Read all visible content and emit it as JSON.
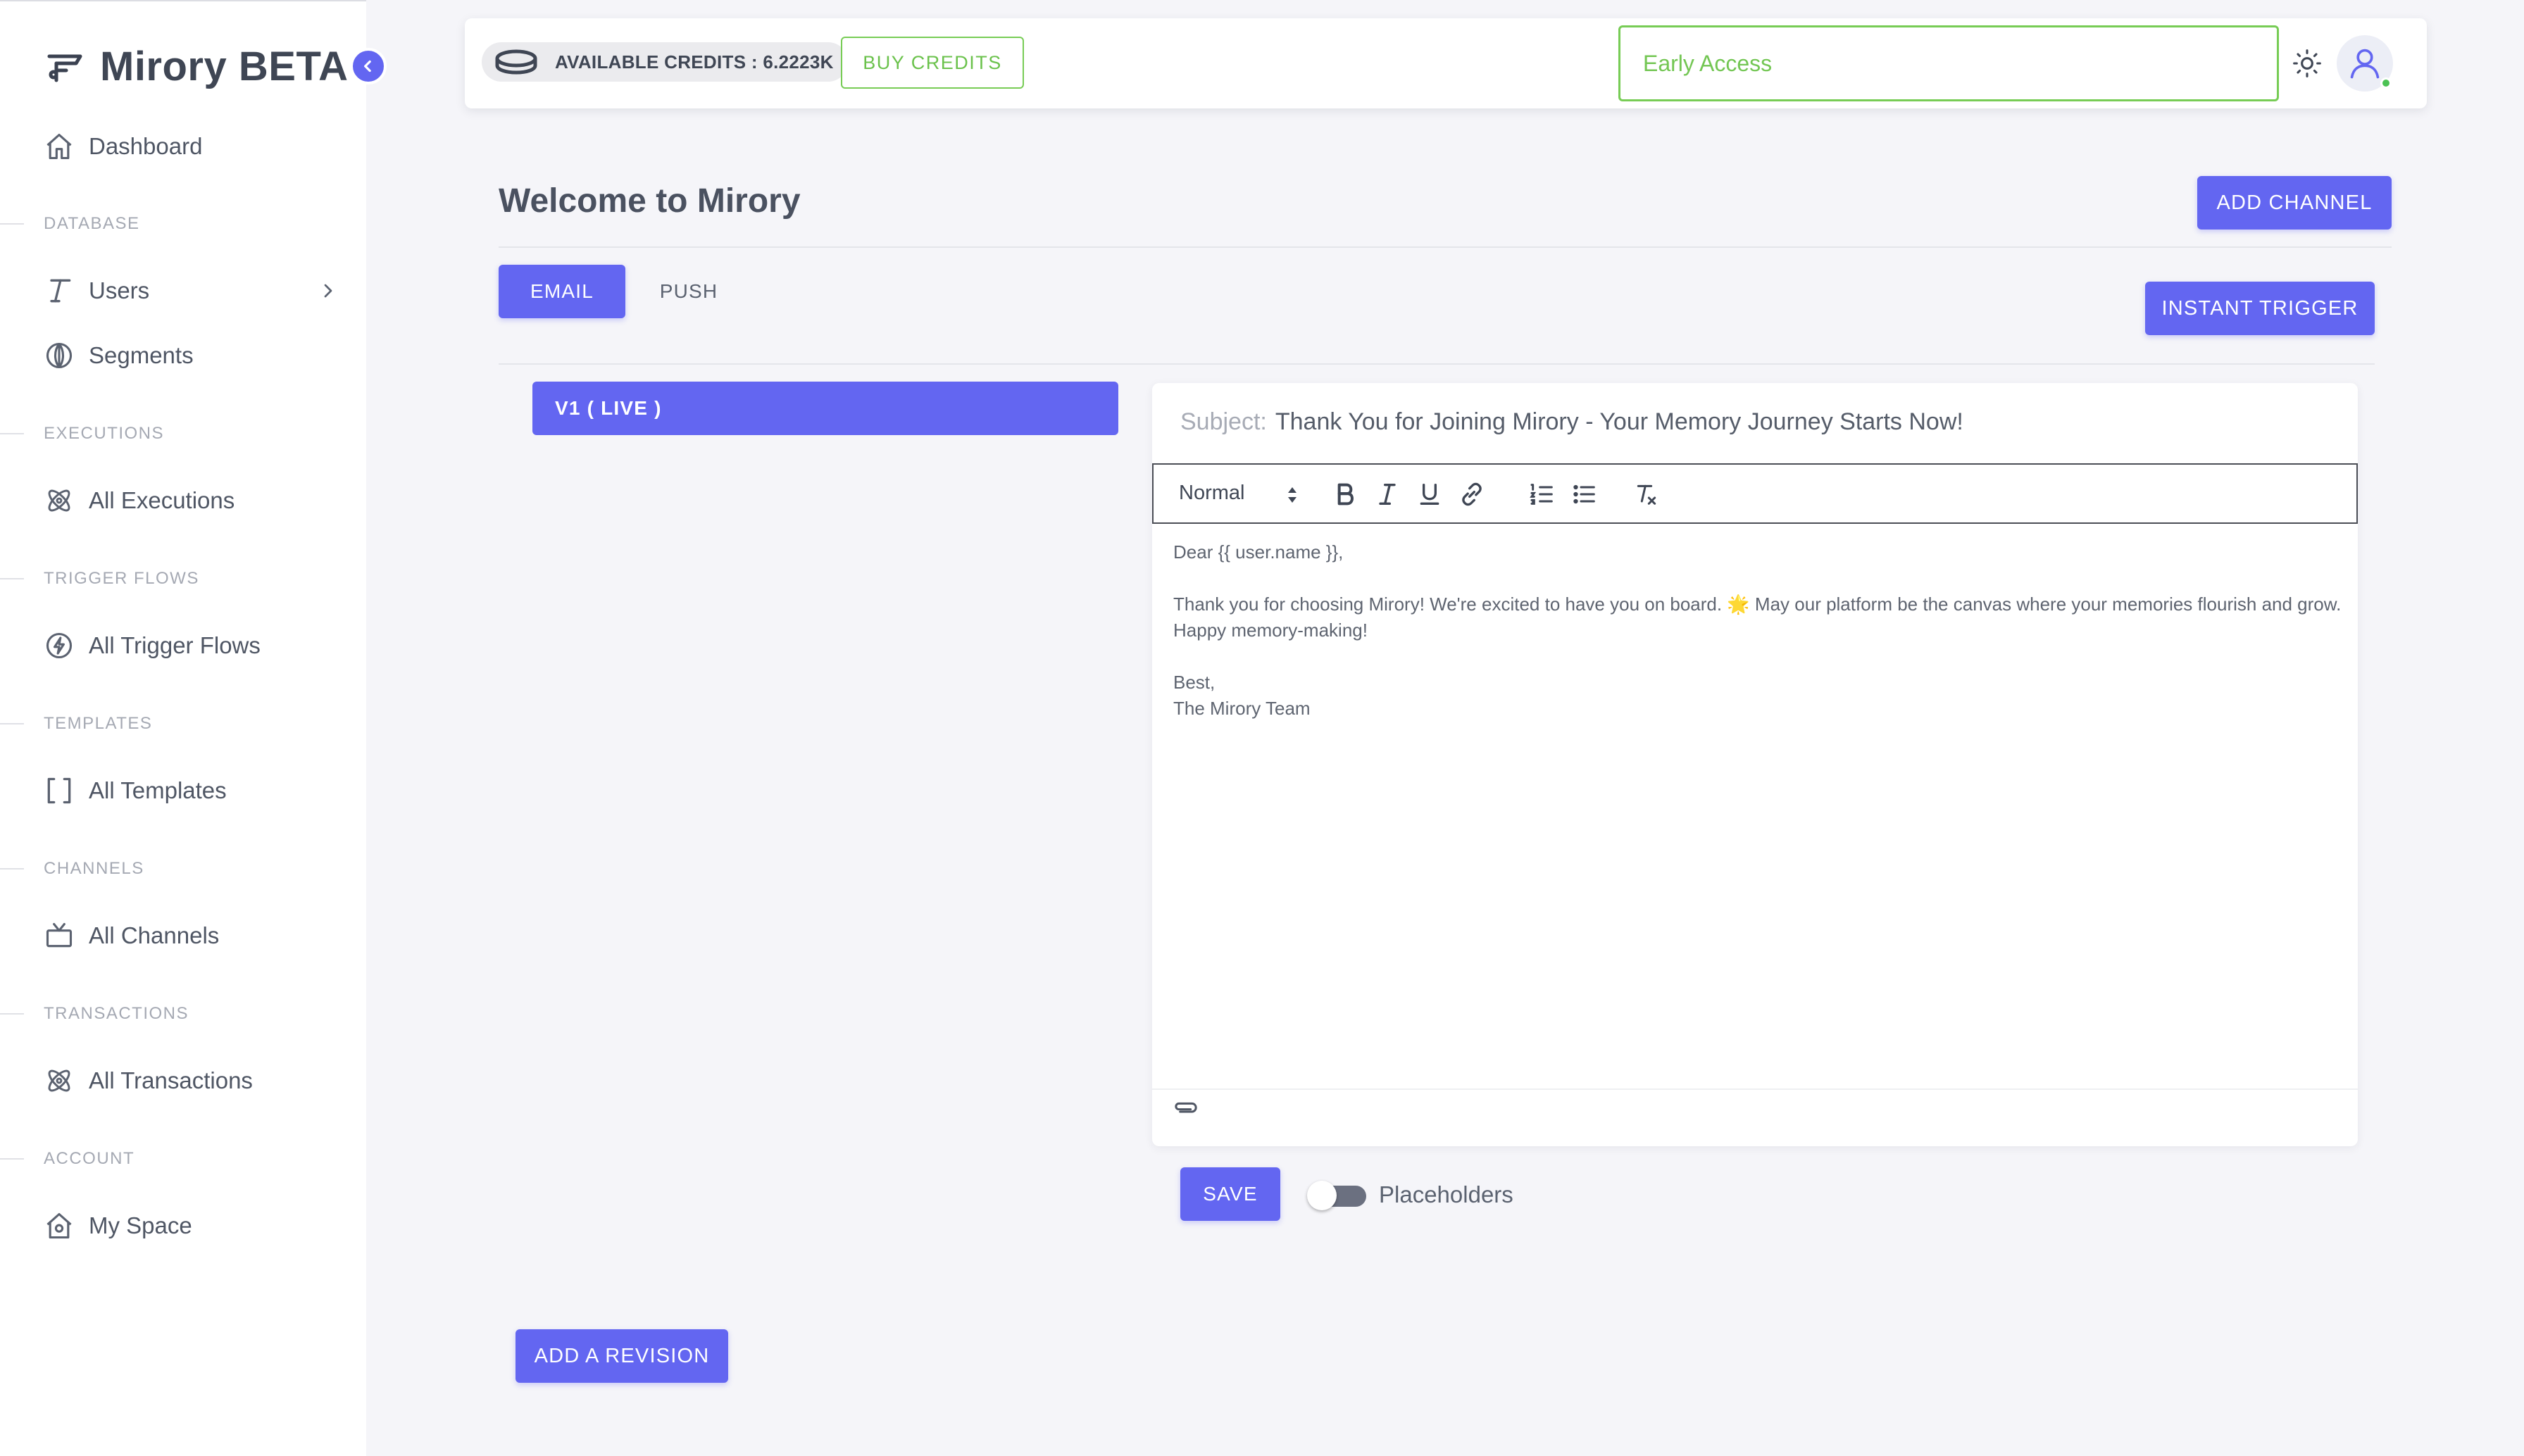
{
  "app": {
    "name": "Mirory BETA"
  },
  "sidebar": {
    "dashboard": "Dashboard",
    "sections": [
      {
        "title": "DATABASE",
        "items": [
          {
            "label": "Users"
          },
          {
            "label": "Segments"
          }
        ]
      },
      {
        "title": "EXECUTIONS",
        "items": [
          {
            "label": "All Executions"
          }
        ]
      },
      {
        "title": "TRIGGER FLOWS",
        "items": [
          {
            "label": "All Trigger Flows"
          }
        ]
      },
      {
        "title": "TEMPLATES",
        "items": [
          {
            "label": "All Templates"
          }
        ]
      },
      {
        "title": "CHANNELS",
        "items": [
          {
            "label": "All Channels"
          }
        ]
      },
      {
        "title": "TRANSACTIONS",
        "items": [
          {
            "label": "All Transactions"
          }
        ]
      },
      {
        "title": "ACCOUNT",
        "items": [
          {
            "label": "My Space"
          }
        ]
      }
    ]
  },
  "topbar": {
    "credits_label": "AVAILABLE CREDITS : 6.2223K",
    "buy_credits": "BUY CREDITS",
    "early_access_placeholder": "Early Access"
  },
  "main": {
    "title": "Welcome to Mirory",
    "add_channel": "ADD CHANNEL",
    "tabs": [
      {
        "label": "EMAIL",
        "active": true
      },
      {
        "label": "PUSH",
        "active": false
      }
    ],
    "instant_trigger": "INSTANT TRIGGER",
    "version_label": "V1 ( LIVE )",
    "add_revision": "ADD A REVISION"
  },
  "editor": {
    "subject_label": "Subject:",
    "subject_value": "Thank You for Joining Mirory - Your Memory Journey Starts Now!",
    "format_select": "Normal",
    "body": {
      "greeting": "Dear {{ user.name }},",
      "para1": "Thank you for choosing Mirory! We're excited to have you on board. 🌟 May our platform be the canvas where your memories flourish and grow.",
      "para2": "Happy memory-making!",
      "signoff": "Best,",
      "signature": "The Mirory Team"
    },
    "save": "SAVE",
    "placeholders_label": "Placeholders",
    "placeholders_enabled": false
  },
  "colors": {
    "primary": "#6366f1",
    "success": "#77cc55",
    "sidebar_bg": "#ffffff",
    "page_bg": "#f5f5f9"
  },
  "icons": {
    "brand": "logo-icon",
    "collapse": "chevron-left-icon",
    "dashboard": "home-icon",
    "users": "type-icon",
    "segments": "globe-icon",
    "executions": "atom-icon",
    "trigger_flows": "bolt-circle-icon",
    "templates": "brackets-icon",
    "channels": "tv-icon",
    "transactions": "atom-icon",
    "my_space": "house-icon",
    "credits": "coin-icon",
    "theme": "sun-icon",
    "avatar": "user-icon",
    "attach": "paperclip-icon"
  }
}
